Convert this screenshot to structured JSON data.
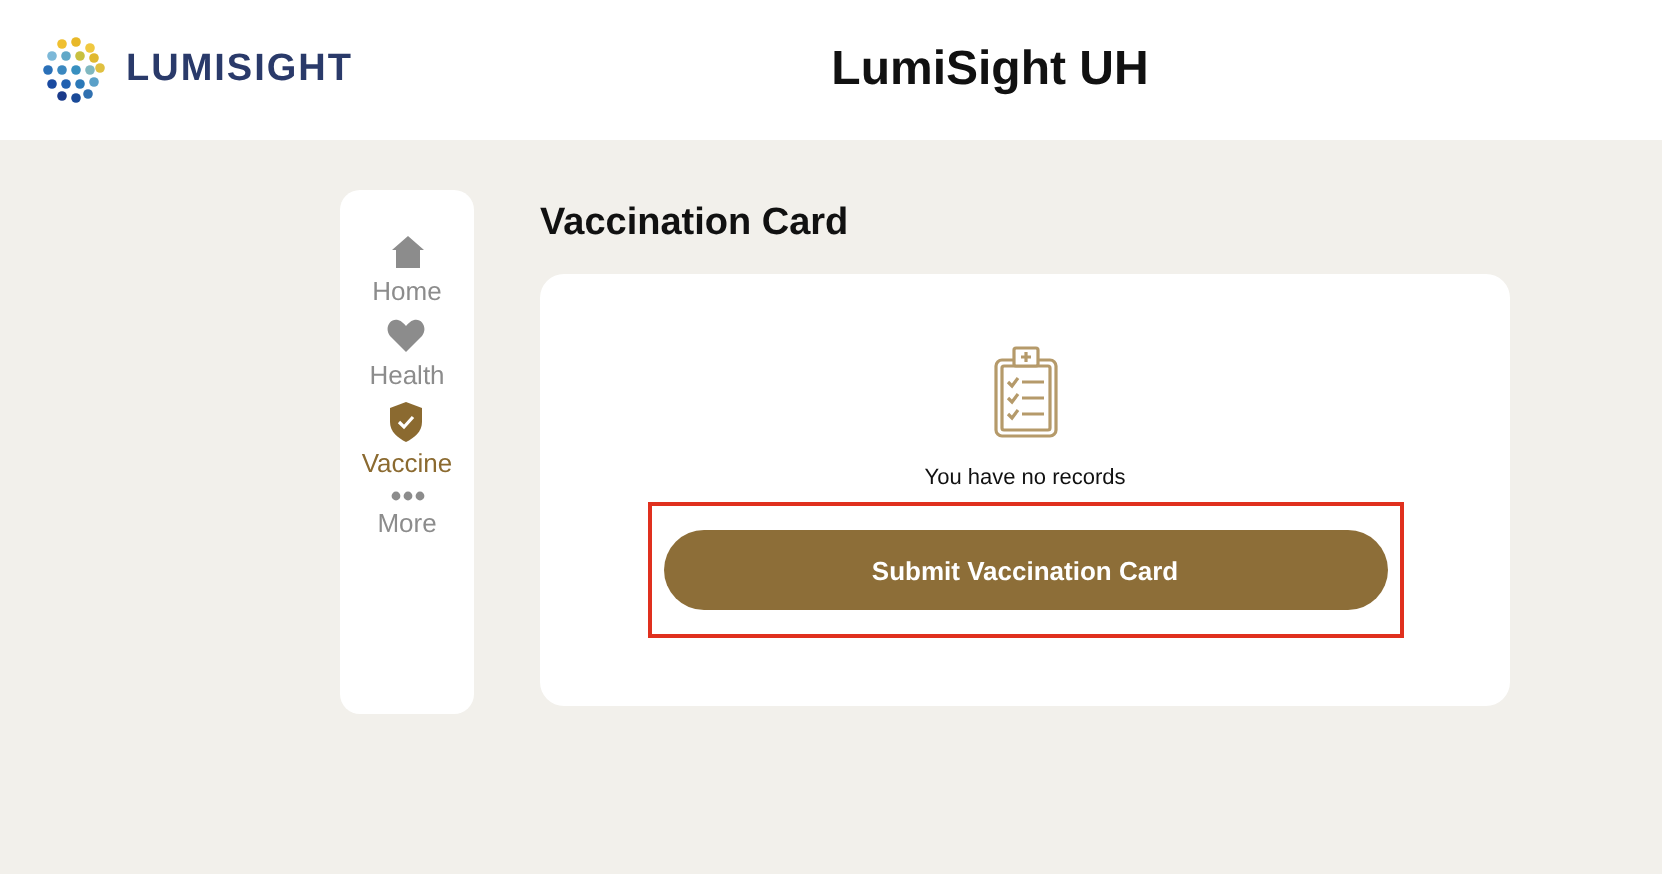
{
  "header": {
    "brand": "LUMISIGHT",
    "title": "LumiSight UH"
  },
  "nav": [
    {
      "kind": "home",
      "label": "Home",
      "selected": false
    },
    {
      "kind": "health",
      "label": "Health",
      "selected": false
    },
    {
      "kind": "vaccine",
      "label": "Vaccine",
      "selected": true
    },
    {
      "kind": "more",
      "label": "More",
      "selected": false
    }
  ],
  "page_title": "Vaccination Card",
  "empty_message": "You have no records",
  "submit_button": {
    "label": "Submit Vaccination Card",
    "highlighted": true
  }
}
